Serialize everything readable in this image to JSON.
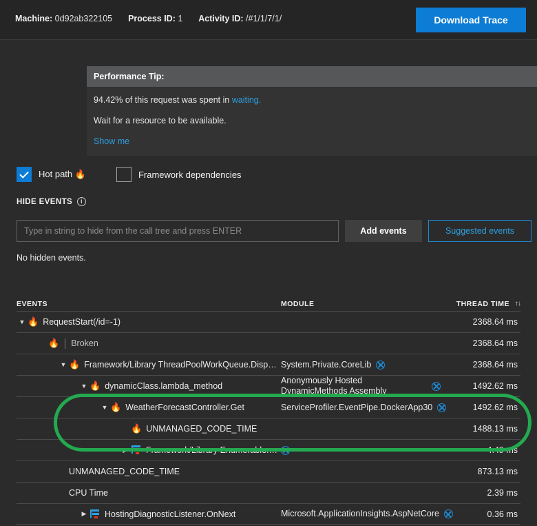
{
  "topbar": {
    "machine_label": "Machine:",
    "machine_value": "0d92ab322105",
    "process_label": "Process ID:",
    "process_value": "1",
    "activity_label": "Activity ID:",
    "activity_value": "/#1/1/7/1/",
    "download_button": "Download Trace",
    "accent_color": "#0c7cd5"
  },
  "performance_tip": {
    "header": "Performance Tip:",
    "line1_prefix": "94.42% of this request was spent in ",
    "line1_link": "waiting.",
    "line2": "Wait for a resource to be available.",
    "show_me": "Show me"
  },
  "filters": {
    "hot_path_label": "Hot path",
    "hot_path_icon": "flame-icon",
    "hot_path_checked": true,
    "framework_deps_label": "Framework dependencies",
    "framework_deps_checked": false
  },
  "hide_events": {
    "title": "HIDE EVENTS",
    "info_icon": "info-icon",
    "input_placeholder": "Type in string to hide from the call tree and press ENTER",
    "input_value": "",
    "add_button": "Add events",
    "suggested_button": "Suggested events",
    "status": "No hidden events."
  },
  "table": {
    "headers": {
      "events": "EVENTS",
      "module": "MODULE",
      "thread_time": "THREAD TIME",
      "sort_icon": "sort-updown-icon"
    },
    "rows": [
      {
        "indent": 0,
        "caret": "down",
        "icon": "flame-icon",
        "name": "RequestStart(/id=-1)",
        "divider": false,
        "module": "",
        "module_x": false,
        "time": "2368.64 ms",
        "muted": false
      },
      {
        "indent": 1,
        "caret": "none",
        "icon": "flame-icon",
        "name": "Broken",
        "divider": true,
        "module": "",
        "module_x": false,
        "time": "2368.64 ms",
        "muted": true
      },
      {
        "indent": 2,
        "caret": "down",
        "icon": "flame-icon",
        "name": "Framework/Library ThreadPoolWorkQueue.Dispatch",
        "divider": false,
        "module": "System.Private.CoreLib",
        "module_x": true,
        "time": "2368.64 ms",
        "muted": false
      },
      {
        "indent": 3,
        "caret": "down",
        "icon": "flame-icon",
        "name": "dynamicClass.lambda_method",
        "divider": false,
        "module": "Anonymously Hosted DynamicMethods Assembly",
        "module_x": true,
        "time": "1492.62 ms",
        "muted": false
      },
      {
        "indent": 4,
        "caret": "down",
        "icon": "flame-icon",
        "name": "WeatherForecastController.Get",
        "divider": false,
        "module": "ServiceProfiler.EventPipe.DockerApp30",
        "module_x": true,
        "time": "1492.62 ms",
        "muted": false
      },
      {
        "indent": 5,
        "caret": "none",
        "icon": "flame-icon",
        "name": "UNMANAGED_CODE_TIME",
        "divider": false,
        "module": "",
        "module_x": false,
        "time": "1488.13 ms",
        "muted": false
      },
      {
        "indent": 5,
        "caret": "right",
        "icon": "gantt-icon",
        "name": "Framework/Library Enumerable.ToArray System.Linq",
        "divider": false,
        "module": "",
        "module_x": true,
        "time": "4.49 ms",
        "muted": false
      },
      {
        "indent": 2,
        "caret": "none",
        "icon": "none",
        "name": "UNMANAGED_CODE_TIME",
        "divider": false,
        "module": "",
        "module_x": false,
        "time": "873.13 ms",
        "muted": false
      },
      {
        "indent": 2,
        "caret": "none",
        "icon": "none",
        "name": "CPU Time",
        "divider": false,
        "module": "",
        "module_x": false,
        "time": "2.39 ms",
        "muted": false
      },
      {
        "indent": 3,
        "caret": "right",
        "icon": "gantt-icon",
        "name": "HostingDiagnosticListener.OnNext",
        "divider": false,
        "module": "Microsoft.ApplicationInsights.AspNetCore",
        "module_x": true,
        "time": "0.36 ms",
        "muted": false
      }
    ]
  },
  "annotation": {
    "highlight_color": "#23a94f",
    "shape": "rounded-rect-outline"
  }
}
